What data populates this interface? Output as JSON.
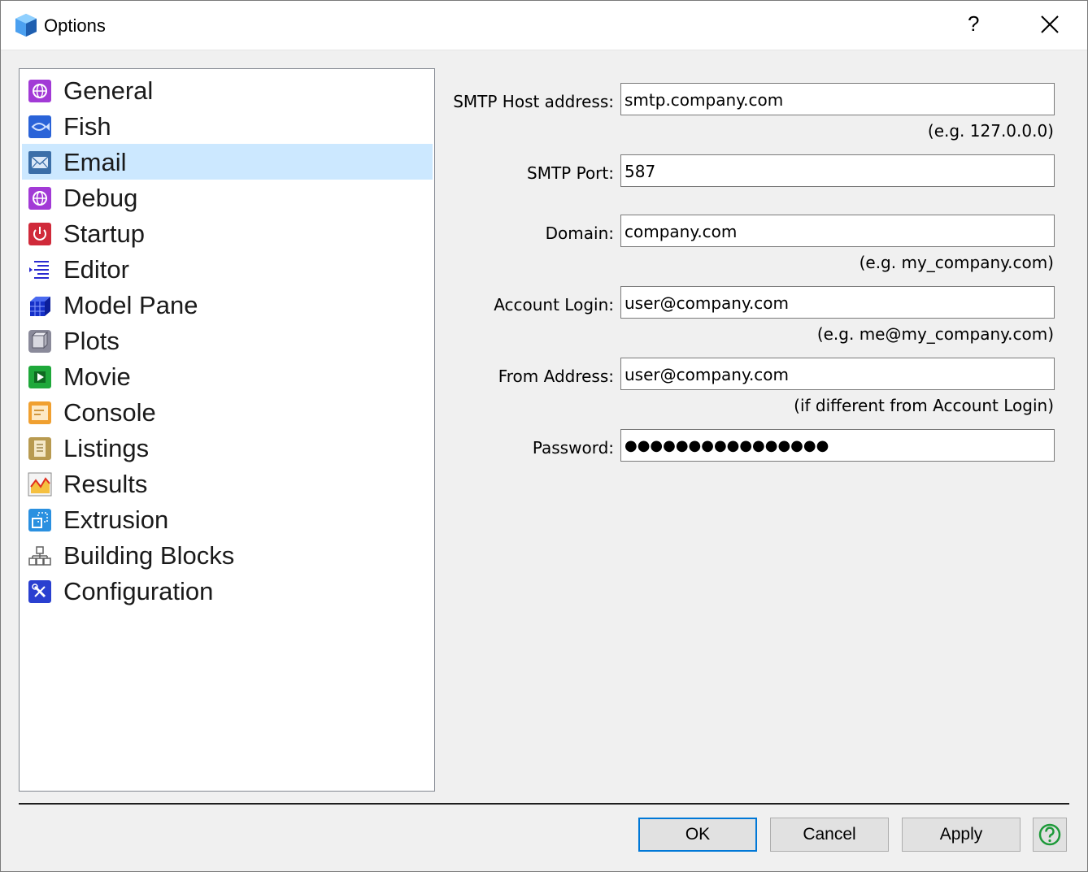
{
  "window": {
    "title": "Options",
    "help_glyph": "?",
    "close_icon": "close-icon"
  },
  "tree": {
    "items": [
      {
        "label": "General",
        "icon": "globe-icon",
        "color": "#a23ad6"
      },
      {
        "label": "Fish",
        "icon": "fish-icon",
        "color": "#2a63d8"
      },
      {
        "label": "Email",
        "icon": "envelope-icon",
        "color": "#3b6ea8",
        "selected": true
      },
      {
        "label": "Debug",
        "icon": "globe-icon",
        "color": "#a23ad6"
      },
      {
        "label": "Startup",
        "icon": "power-icon",
        "color": "#d02a3a"
      },
      {
        "label": "Editor",
        "icon": "list-icon",
        "color": "#2a2ad0"
      },
      {
        "label": "Model Pane",
        "icon": "cube-icon",
        "color": "#1530c8"
      },
      {
        "label": "Plots",
        "icon": "box-icon",
        "color": "#8a8a9a"
      },
      {
        "label": "Movie",
        "icon": "play-icon",
        "color": "#1ea83a"
      },
      {
        "label": "Console",
        "icon": "console-icon",
        "color": "#f0a030"
      },
      {
        "label": "Listings",
        "icon": "document-icon",
        "color": "#b89a50"
      },
      {
        "label": "Results",
        "icon": "chart-icon",
        "color": "#e8a020"
      },
      {
        "label": "Extrusion",
        "icon": "extrude-icon",
        "color": "#2a90e0"
      },
      {
        "label": "Building Blocks",
        "icon": "blocks-icon",
        "color": "#606060"
      },
      {
        "label": "Configuration",
        "icon": "tools-icon",
        "color": "#2a40d0"
      }
    ]
  },
  "form": {
    "smtp_host": {
      "label": "SMTP Host address:",
      "value": "smtp.company.com",
      "hint": "(e.g. 127.0.0.0)"
    },
    "smtp_port": {
      "label": "SMTP Port:",
      "value": "587"
    },
    "domain": {
      "label": "Domain:",
      "value": "company.com",
      "hint": "(e.g. my_company.com)"
    },
    "account_login": {
      "label": "Account Login:",
      "value": "user@company.com",
      "hint": "(e.g. me@my_company.com)"
    },
    "from_address": {
      "label": "From Address:",
      "value": "user@company.com",
      "hint": "(if different from Account Login)"
    },
    "password": {
      "label": "Password:",
      "value": "●●●●●●●●●●●●●●●●"
    }
  },
  "buttons": {
    "ok": "OK",
    "cancel": "Cancel",
    "apply": "Apply",
    "help_icon": "help-circle-icon"
  }
}
